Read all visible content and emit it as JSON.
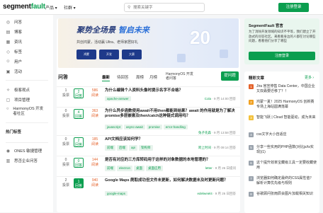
{
  "header": {
    "logo_main": "segment",
    "logo_accent": "fault",
    "nav": [
      "产品 ▾",
      "社群 ▾"
    ],
    "search_placeholder": "搜索关键字",
    "register_label": "注册登录"
  },
  "sidebar": {
    "items": [
      {
        "label": "问答",
        "icon": "question-icon"
      },
      {
        "label": "博客",
        "icon": "blog-icon"
      },
      {
        "label": "资讯",
        "icon": "news-icon"
      },
      {
        "label": "标签",
        "icon": "tag-icon"
      },
      {
        "label": "用户",
        "icon": "user-icon"
      },
      {
        "label": "活动",
        "icon": "activity-icon"
      }
    ],
    "sections": [
      {
        "label": "极客观点",
        "icon": "bulb-icon"
      },
      {
        "label": "项目管理",
        "icon": "project-icon"
      },
      {
        "label": "HarmonyOS 开发者社区",
        "icon": "harmony-icon"
      }
    ],
    "hot_title": "热门标签",
    "footer": [
      {
        "label": "ONES 敏捷管理",
        "icon": "ones-icon"
      },
      {
        "label": "思否企业问答",
        "icon": "enterprise-icon"
      }
    ]
  },
  "banner": {
    "title_a": "聚势全场景",
    "title_b": "智启未来",
    "subtitle": "共创鸿蒙，活动赢 Ultra、老师家居好礼",
    "chips": [
      "鸿蒙",
      "开发",
      "大赛"
    ],
    "number": "20"
  },
  "questions_header": {
    "title": "问答",
    "tabs": [
      "最新",
      "待回答",
      "周榜",
      "月榜",
      "HarmonyOS 开发者问答"
    ],
    "active_tab": "最新",
    "ask_label": "提问题"
  },
  "questions": [
    {
      "votes": "1",
      "votes_label": "投票",
      "answers": "2",
      "answers_label": "回答",
      "accepted": false,
      "views": "586",
      "views_label": "阅读",
      "title": "为什么编辑个人资料头像时提示名字不合格？",
      "tags": [
        "apache-answer"
      ],
      "user": "Cola",
      "time": "· 9 月 14:00 回答"
    },
    {
      "votes": "0",
      "votes_label": "投票",
      "answers": "4",
      "answers_label": "回答",
      "accepted": false,
      "views": "363",
      "views_label": "阅读",
      "title": "为什么异步函数使用await不用then都能到结果？await 的作用就是为了解决promise多层嵌套及then/catch这种链式调用吗？",
      "tags": [
        "javascript",
        "async-await",
        "promise",
        "error-handling"
      ],
      "user": "兔子先森",
      "time": "· 9 月 13:58 回答"
    },
    {
      "votes": "0",
      "votes_label": "投票",
      "answers": "2",
      "answers_label": "回答",
      "accepted": false,
      "views": "185",
      "views_label": "阅读",
      "title": "API文档应该如何学？",
      "tags": [
        "前端",
        "后端",
        "api",
        "架构师"
      ],
      "user": "跨上时间",
      "time": "· 9 月 09:14 回答"
    },
    {
      "votes": "0",
      "votes_label": "投票",
      "answers": "0",
      "answers_label": "回答",
      "accepted": false,
      "views": "144",
      "views_label": "阅读",
      "title": "是否有对应的三方库转码用于这样的对象数据的本地管理的？",
      "tags": [
        "前端",
        "electron",
        "桌面",
        "桌面应用"
      ],
      "user": "letter",
      "time": "· 9 月 26 日提问"
    },
    {
      "votes": "2",
      "votes_label": "投票",
      "answers": "1",
      "answers_label": "回答",
      "accepted": true,
      "views": "940",
      "views_label": "阅读",
      "title": "Google Maps 爬取成功但文件未更新，如何解决数据未及时更新问题？",
      "tags": [
        "google-maps"
      ],
      "user": "edelweiel4",
      "time": "· 9 月 26 日回答"
    }
  ],
  "promo": {
    "title": "SegmentFault 官言",
    "desc": "为了消除开发领域的知识不平等，我们建立了开放式的问答社区。来看看身边的人都在讨论哪些问题，看看他们分享了哪些",
    "button": "注册登录"
  },
  "articles": {
    "header": "精彩文章",
    "more": "更多 ›",
    "items": [
      {
        "rank": "1",
        "color": "#e4632c",
        "title": "Jira 官宣停售 Data Center，中国企业又双叒要迁移了？！"
      },
      {
        "rank": "2",
        "color": "#f0a020",
        "title": "鸿蒙一夏！2025 HarmonyOS 创新赛专场上海站圆满落幕"
      },
      {
        "rank": "3",
        "color": "#f3c13a",
        "title": "智能飞跃 | Cloud 智能驱动，成为未来"
      },
      {
        "rank": "4",
        "color": "#9aa3ad",
        "title": "css文字大小自适应"
      },
      {
        "rank": "5",
        "color": "#9aa3ad",
        "title": "分享一些实用的PHP函数(对比js/ts实现)(1)"
      },
      {
        "rank": "6",
        "color": "#9aa3ad",
        "title": "这个提升效率宝藏级工具一定要收藏使用"
      },
      {
        "rank": "7",
        "color": "#9aa3ad",
        "title": "浏览器如何确定最终的CSS属性值？解析计算优先级与规则"
      },
      {
        "rank": "8",
        "color": "#9aa3ad",
        "title": "谷歌顾问张雨辰会图片加载相关知识"
      }
    ]
  }
}
